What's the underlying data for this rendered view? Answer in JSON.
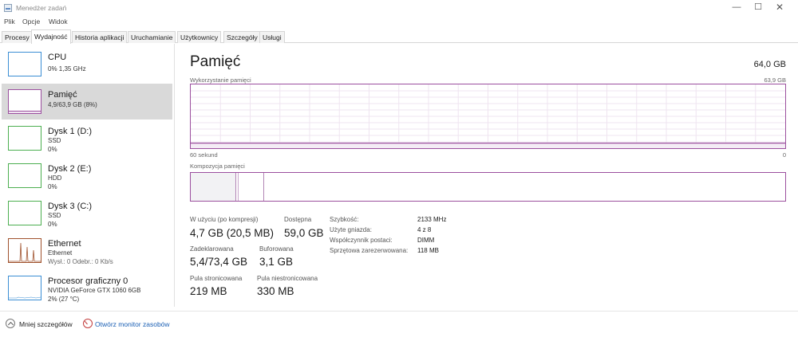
{
  "window": {
    "title": "Menedżer zadań",
    "min_glyph": "—",
    "max_glyph": "☐",
    "close_glyph": "✕"
  },
  "menu": [
    "Plik",
    "Opcje",
    "Widok"
  ],
  "tabs": [
    "Procesy",
    "Wydajność",
    "Historia aplikacji",
    "Uruchamianie",
    "Użytkownicy",
    "Szczegóły",
    "Usługi"
  ],
  "active_tab": "Wydajność",
  "sidebar": {
    "items": [
      {
        "title": "CPU",
        "line1": "0%  1,35 GHz",
        "line2": "",
        "line3": "",
        "color": "#3b8ed4"
      },
      {
        "title": "Pamięć",
        "line1": "4,9/63,9 GB (8%)",
        "line2": "",
        "line3": "",
        "color": "#9b4f9e"
      },
      {
        "title": "Dysk 1 (D:)",
        "line1": "SSD",
        "line2": "0%",
        "line3": "",
        "color": "#4caf50"
      },
      {
        "title": "Dysk 2 (E:)",
        "line1": "HDD",
        "line2": "0%",
        "line3": "",
        "color": "#4caf50"
      },
      {
        "title": "Dysk 3 (C:)",
        "line1": "SSD",
        "line2": "0%",
        "line3": "",
        "color": "#4caf50"
      },
      {
        "title": "Ethernet",
        "line1": "Ethernet",
        "line2": "Wysł.: 0  Odebr.: 0 Kb/s",
        "line3": "",
        "color": "#a0522d"
      },
      {
        "title": "Procesor graficzny 0",
        "line1": "NVIDIA GeForce GTX 1060 6GB",
        "line2": "2%  (27 °C)",
        "line3": "",
        "color": "#3b8ed4"
      }
    ]
  },
  "main": {
    "title": "Pamięć",
    "total": "64,0 GB",
    "usage_label": "Wykorzystanie pamięci",
    "usage_max": "63,9 GB",
    "time_label": "60 sekund",
    "time_zero": "0",
    "composition_label": "Kompozycja pamięci",
    "usage_fraction": 0.08,
    "stats": [
      {
        "label": "W użyciu (po kompresji)",
        "value": "4,7 GB (20,5 MB)"
      },
      {
        "label": "Dostępna",
        "value": "59,0 GB"
      },
      {
        "label": "Zadeklarowana",
        "value": "5,4/73,4 GB"
      },
      {
        "label": "Buforowana",
        "value": "3,1 GB"
      },
      {
        "label": "Pula stronicowana",
        "value": "219 MB"
      },
      {
        "label": "Pula niestronicowana",
        "value": "330 MB"
      }
    ],
    "details": [
      {
        "label": "Szybkość:",
        "value": "2133 MHz"
      },
      {
        "label": "Użyte gniazda:",
        "value": "4 z 8"
      },
      {
        "label": "Współczynnik postaci:",
        "value": "DIMM"
      },
      {
        "label": "Sprzętowa zarezerwowana:",
        "value": "118 MB"
      }
    ]
  },
  "footer": {
    "fewer_details": "Mniej szczegółów",
    "resource_monitor": "Otwórz monitor zasobów"
  },
  "colors": {
    "memory": "#9b4f9e",
    "cpu": "#3b8ed4",
    "disk": "#4caf50",
    "ethernet": "#a0522d",
    "link": "#1a5fb4"
  }
}
